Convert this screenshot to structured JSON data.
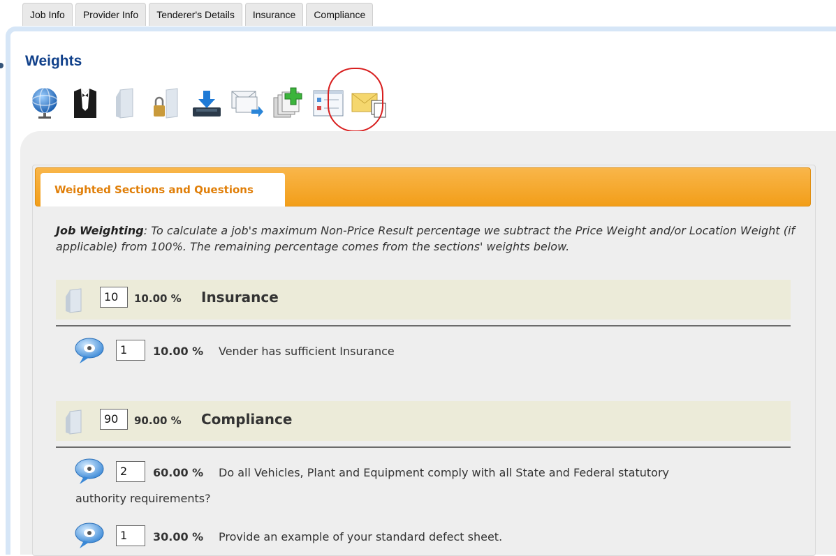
{
  "tabs": [
    "Job Info",
    "Provider Info",
    "Tenderer's Details",
    "Insurance",
    "Compliance"
  ],
  "page_title": "Weights",
  "toolbar_icons": [
    "globe-icon",
    "tuxedo-icon",
    "document-icon",
    "locked-document-icon",
    "download-tray-icon",
    "forward-email-icon",
    "add-pages-icon",
    "checklist-form-icon",
    "envelope-copy-icon"
  ],
  "section_tab": "Weighted Sections and Questions",
  "description": {
    "label": "Job Weighting",
    "text": ": To calculate a job's maximum Non-Price Result percentage we subtract the Price Weight and/or Location Weight (if applicable) from 100%.  The remaining percentage comes from the sections' weights below."
  },
  "sections": [
    {
      "weight": "10",
      "percent": "10.00 %",
      "title": "Insurance",
      "questions": [
        {
          "weight": "1",
          "percent": "10.00 %",
          "text": "Vender has sufficient Insurance"
        }
      ]
    },
    {
      "weight": "90",
      "percent": "90.00 %",
      "title": "Compliance",
      "questions": [
        {
          "weight": "2",
          "percent": "60.00 %",
          "text": "Do all Vehicles, Plant and Equipment comply with all State and Federal statutory",
          "text_cont": "authority requirements?"
        },
        {
          "weight": "1",
          "percent": "30.00 %",
          "text": "Provide an example of your standard defect sheet."
        }
      ]
    }
  ],
  "colors": {
    "accent_orange": "#f29e19",
    "title_blue": "#10408a",
    "highlight_red": "#d81f1f"
  }
}
